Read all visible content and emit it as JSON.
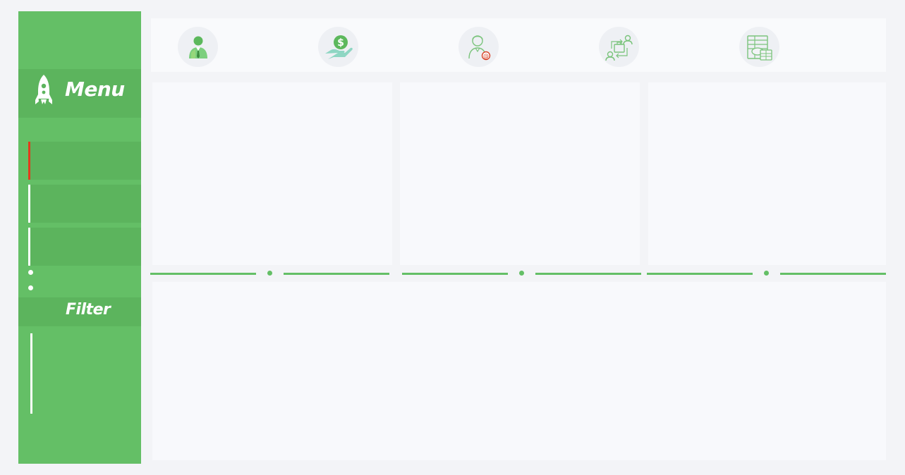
{
  "sidebar": {
    "menu_label": "Menu",
    "filter_label": "Filter",
    "nav_items": [
      {
        "label": "",
        "active": true
      },
      {
        "label": "",
        "active": false
      },
      {
        "label": "",
        "active": false
      }
    ]
  },
  "topbar": {
    "icons": [
      "person-icon",
      "money-hand-icon",
      "employee-email-icon",
      "transfer-people-icon",
      "spreadsheet-money-icon"
    ]
  },
  "colors": {
    "sidebar_green": "#64bf66",
    "sidebar_dark_green": "#5cb45d",
    "active_indicator": "#e23b1c",
    "background": "#f3f4f7",
    "panel": "#f8f9fc"
  }
}
